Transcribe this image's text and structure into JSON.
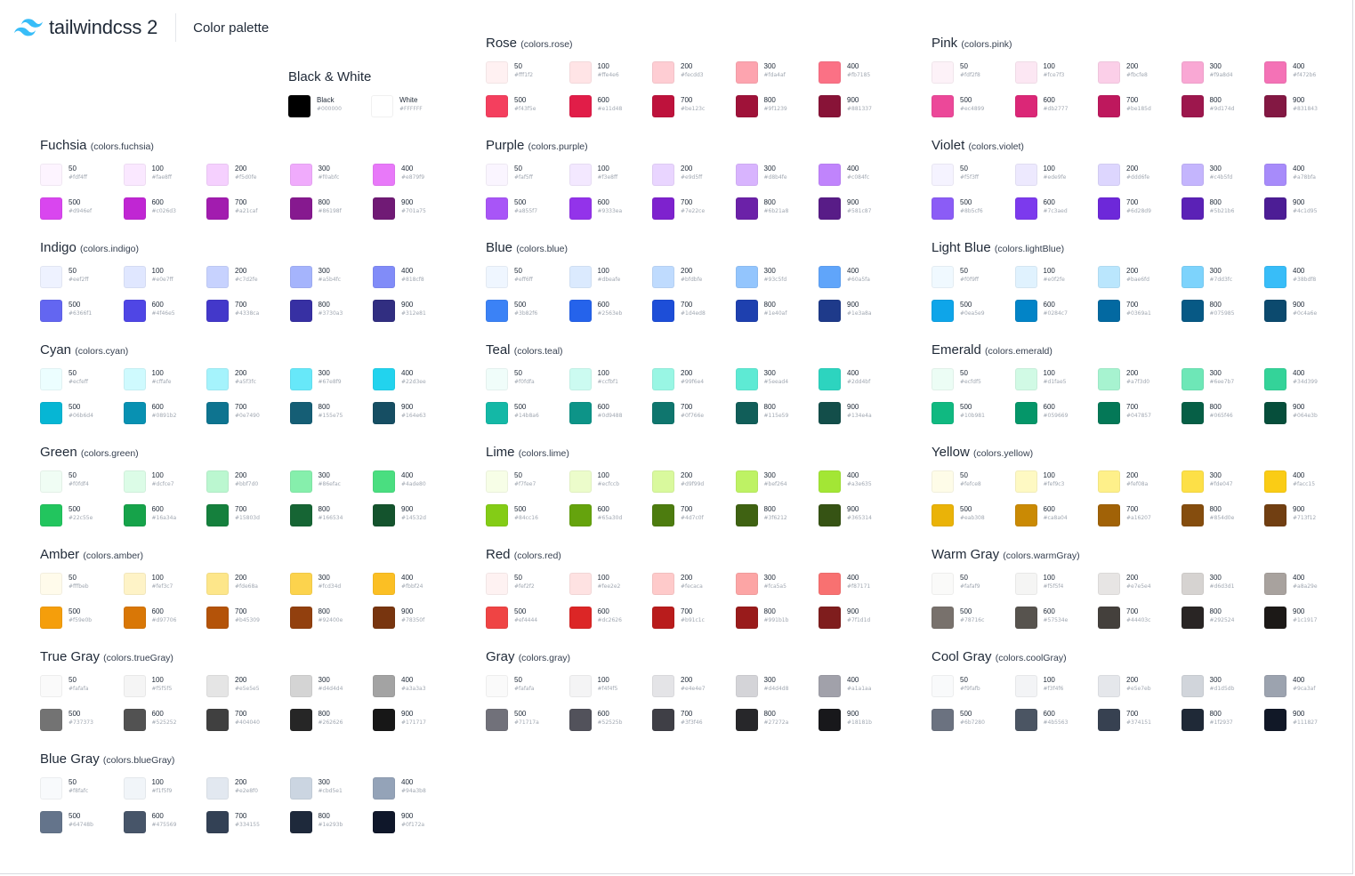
{
  "app": {
    "logo_text": "tailwindcss 2",
    "title": "Color palette",
    "brand_color": "#38bdf8"
  },
  "black_white": {
    "title": "Black & White",
    "swatches": [
      {
        "name": "Black",
        "hex": "#000000",
        "color": "#000000"
      },
      {
        "name": "White",
        "hex": "#FFFFFF",
        "color": "#FFFFFF"
      }
    ]
  },
  "groups": [
    {
      "id": "rose",
      "name": "Rose",
      "key": "(colors.rose)",
      "colors": [
        "#fff1f2",
        "#ffe4e6",
        "#fecdd3",
        "#fda4af",
        "#fb7185",
        "#f43f5e",
        "#e11d48",
        "#be123c",
        "#9f1239",
        "#881337"
      ]
    },
    {
      "id": "pink",
      "name": "Pink",
      "key": "(colors.pink)",
      "colors": [
        "#fdf2f8",
        "#fce7f3",
        "#fbcfe8",
        "#f9a8d4",
        "#f472b6",
        "#ec4899",
        "#db2777",
        "#be185d",
        "#9d174d",
        "#831843"
      ]
    },
    {
      "id": "fuchsia",
      "name": "Fuchsia",
      "key": "(colors.fuchsia)",
      "colors": [
        "#fdf4ff",
        "#fae8ff",
        "#f5d0fe",
        "#f0abfc",
        "#e879f9",
        "#d946ef",
        "#c026d3",
        "#a21caf",
        "#86198f",
        "#701a75"
      ]
    },
    {
      "id": "purple",
      "name": "Purple",
      "key": "(colors.purple)",
      "colors": [
        "#faf5ff",
        "#f3e8ff",
        "#e9d5ff",
        "#d8b4fe",
        "#c084fc",
        "#a855f7",
        "#9333ea",
        "#7e22ce",
        "#6b21a8",
        "#581c87"
      ]
    },
    {
      "id": "violet",
      "name": "Violet",
      "key": "(colors.violet)",
      "colors": [
        "#f5f3ff",
        "#ede9fe",
        "#ddd6fe",
        "#c4b5fd",
        "#a78bfa",
        "#8b5cf6",
        "#7c3aed",
        "#6d28d9",
        "#5b21b6",
        "#4c1d95"
      ]
    },
    {
      "id": "indigo",
      "name": "Indigo",
      "key": "(colors.indigo)",
      "colors": [
        "#eef2ff",
        "#e0e7ff",
        "#c7d2fe",
        "#a5b4fc",
        "#818cf8",
        "#6366f1",
        "#4f46e5",
        "#4338ca",
        "#3730a3",
        "#312e81"
      ]
    },
    {
      "id": "blue",
      "name": "Blue",
      "key": "(colors.blue)",
      "colors": [
        "#eff6ff",
        "#dbeafe",
        "#bfdbfe",
        "#93c5fd",
        "#60a5fa",
        "#3b82f6",
        "#2563eb",
        "#1d4ed8",
        "#1e40af",
        "#1e3a8a"
      ]
    },
    {
      "id": "lightBlue",
      "name": "Light Blue",
      "key": "(colors.lightBlue)",
      "colors": [
        "#f0f9ff",
        "#e0f2fe",
        "#bae6fd",
        "#7dd3fc",
        "#38bdf8",
        "#0ea5e9",
        "#0284c7",
        "#0369a1",
        "#075985",
        "#0c4a6e"
      ]
    },
    {
      "id": "cyan",
      "name": "Cyan",
      "key": "(colors.cyan)",
      "colors": [
        "#ecfeff",
        "#cffafe",
        "#a5f3fc",
        "#67e8f9",
        "#22d3ee",
        "#06b6d4",
        "#0891b2",
        "#0e7490",
        "#155e75",
        "#164e63"
      ]
    },
    {
      "id": "teal",
      "name": "Teal",
      "key": "(colors.teal)",
      "colors": [
        "#f0fdfa",
        "#ccfbf1",
        "#99f6e4",
        "#5eead4",
        "#2dd4bf",
        "#14b8a6",
        "#0d9488",
        "#0f766e",
        "#115e59",
        "#134e4a"
      ]
    },
    {
      "id": "emerald",
      "name": "Emerald",
      "key": "(colors.emerald)",
      "colors": [
        "#ecfdf5",
        "#d1fae5",
        "#a7f3d0",
        "#6ee7b7",
        "#34d399",
        "#10b981",
        "#059669",
        "#047857",
        "#065f46",
        "#064e3b"
      ]
    },
    {
      "id": "green",
      "name": "Green",
      "key": "(colors.green)",
      "colors": [
        "#f0fdf4",
        "#dcfce7",
        "#bbf7d0",
        "#86efac",
        "#4ade80",
        "#22c55e",
        "#16a34a",
        "#15803d",
        "#166534",
        "#14532d"
      ]
    },
    {
      "id": "lime",
      "name": "Lime",
      "key": "(colors.lime)",
      "colors": [
        "#f7fee7",
        "#ecfccb",
        "#d9f99d",
        "#bef264",
        "#a3e635",
        "#84cc16",
        "#65a30d",
        "#4d7c0f",
        "#3f6212",
        "#365314"
      ]
    },
    {
      "id": "yellow",
      "name": "Yellow",
      "key": "(colors.yellow)",
      "colors": [
        "#fefce8",
        "#fef9c3",
        "#fef08a",
        "#fde047",
        "#facc15",
        "#eab308",
        "#ca8a04",
        "#a16207",
        "#854d0e",
        "#713f12"
      ]
    },
    {
      "id": "amber",
      "name": "Amber",
      "key": "(colors.amber)",
      "colors": [
        "#fffbeb",
        "#fef3c7",
        "#fde68a",
        "#fcd34d",
        "#fbbf24",
        "#f59e0b",
        "#d97706",
        "#b45309",
        "#92400e",
        "#78350f"
      ]
    },
    {
      "id": "red",
      "name": "Red",
      "key": "(colors.red)",
      "colors": [
        "#fef2f2",
        "#fee2e2",
        "#fecaca",
        "#fca5a5",
        "#f87171",
        "#ef4444",
        "#dc2626",
        "#b91c1c",
        "#991b1b",
        "#7f1d1d"
      ]
    },
    {
      "id": "warmGray",
      "name": "Warm Gray",
      "key": "(colors.warmGray)",
      "colors": [
        "#fafaf9",
        "#f5f5f4",
        "#e7e5e4",
        "#d6d3d1",
        "#a8a29e",
        "#78716c",
        "#57534e",
        "#44403c",
        "#292524",
        "#1c1917"
      ]
    },
    {
      "id": "trueGray",
      "name": "True Gray",
      "key": "(colors.trueGray)",
      "colors": [
        "#fafafa",
        "#f5f5f5",
        "#e5e5e5",
        "#d4d4d4",
        "#a3a3a3",
        "#737373",
        "#525252",
        "#404040",
        "#262626",
        "#171717"
      ]
    },
    {
      "id": "gray",
      "name": "Gray",
      "key": "(colors.gray)",
      "colors": [
        "#fafafa",
        "#f4f4f5",
        "#e4e4e7",
        "#d4d4d8",
        "#a1a1aa",
        "#71717a",
        "#52525b",
        "#3f3f46",
        "#27272a",
        "#18181b"
      ]
    },
    {
      "id": "coolGray",
      "name": "Cool Gray",
      "key": "(colors.coolGray)",
      "colors": [
        "#f9fafb",
        "#f3f4f6",
        "#e5e7eb",
        "#d1d5db",
        "#9ca3af",
        "#6b7280",
        "#4b5563",
        "#374151",
        "#1f2937",
        "#111827"
      ]
    },
    {
      "id": "blueGray",
      "name": "Blue Gray",
      "key": "(colors.blueGray)",
      "colors": [
        "#f8fafc",
        "#f1f5f9",
        "#e2e8f0",
        "#cbd5e1",
        "#94a3b8",
        "#64748b",
        "#475569",
        "#334155",
        "#1e293b",
        "#0f172a"
      ]
    }
  ],
  "shade_names": [
    "50",
    "100",
    "200",
    "300",
    "400",
    "500",
    "600",
    "700",
    "800",
    "900"
  ]
}
